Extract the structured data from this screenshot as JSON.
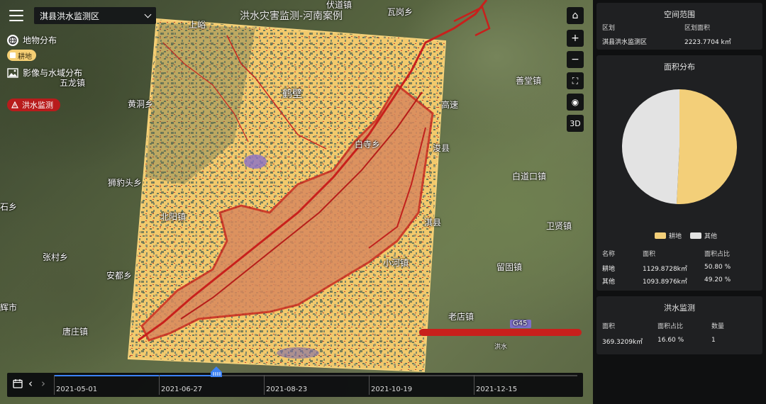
{
  "map": {
    "title": "洪水灾害监测-河南案例",
    "region_select": "淇县洪水监测区",
    "place_labels": [
      {
        "name": "上峪",
        "id": "shangyu"
      },
      {
        "name": "伏道镇",
        "id": "fudao"
      },
      {
        "name": "瓦岗乡",
        "id": "wagang"
      },
      {
        "name": "五龙镇",
        "id": "wulong"
      },
      {
        "name": "鹤壁",
        "id": "hebi"
      },
      {
        "name": "黄洞乡",
        "id": "huangdong"
      },
      {
        "name": "善堂镇",
        "id": "shantang"
      },
      {
        "name": "高速",
        "id": "gaosu"
      },
      {
        "name": "浚县",
        "id": "xunxian"
      },
      {
        "name": "白寺乡",
        "id": "baisi"
      },
      {
        "name": "白道口镇",
        "id": "baidaokou"
      },
      {
        "name": "狮豹头乡",
        "id": "shibaotou"
      },
      {
        "name": "石乡",
        "id": "shixiang"
      },
      {
        "name": "北阳镇",
        "id": "beiyang"
      },
      {
        "name": "淇县",
        "id": "qixian"
      },
      {
        "name": "张村乡",
        "id": "zhangcun"
      },
      {
        "name": "安都乡",
        "id": "andu"
      },
      {
        "name": "小河镇",
        "id": "xiaohe"
      },
      {
        "name": "留固镇",
        "id": "liugu"
      },
      {
        "name": "卫贤镇",
        "id": "weixian"
      },
      {
        "name": "老店镇",
        "id": "laodian"
      },
      {
        "name": "唐庄镇",
        "id": "tangzhuang"
      },
      {
        "name": "辉市",
        "id": "huishi"
      },
      {
        "name": "G45",
        "id": "g45"
      },
      {
        "name": "洪水",
        "id": "hongshui"
      }
    ]
  },
  "layers": {
    "land_use": "地物分布",
    "farmland_chip": "耕地",
    "imagery": "影像与水域分布",
    "flood": "洪水监测"
  },
  "toolbar": {
    "home": "⌂",
    "zoom_in": "+",
    "zoom_out": "−",
    "fullscreen": "⛶",
    "visibility": "◉",
    "view3d": "3D"
  },
  "timeline": {
    "dates": [
      "2021-05-01",
      "2021-06-27",
      "2021-08-23",
      "2021-10-19",
      "2021-12-15"
    ],
    "current_position": 0.31
  },
  "panel": {
    "extent": {
      "title": "空间范围",
      "head_region": "区划",
      "head_area": "区划面积",
      "region": "淇县洪水监测区",
      "area": "2223.7704 k㎡"
    },
    "distribution": {
      "title": "面积分布",
      "legend": [
        {
          "label": "耕地",
          "color": "#f3cf79"
        },
        {
          "label": "其他",
          "color": "#e3e3e3"
        }
      ],
      "headers": [
        "名称",
        "面积",
        "面积占比"
      ],
      "rows": [
        {
          "name": "耕地",
          "area": "1129.8728k㎡",
          "ratio": "50.80 %"
        },
        {
          "name": "其他",
          "area": "1093.8976k㎡",
          "ratio": "49.20 %"
        }
      ]
    },
    "flood": {
      "title": "洪水监测",
      "headers": [
        "面积",
        "面积占比",
        "数量"
      ],
      "row": {
        "area": "369.3209k㎡",
        "ratio": "16.60 %",
        "count": "1"
      }
    }
  },
  "chart_data": {
    "type": "pie",
    "title": "面积分布",
    "categories": [
      "耕地",
      "其他"
    ],
    "values": [
      50.8,
      49.2
    ],
    "colors": [
      "#f3cf79",
      "#e3e3e3"
    ],
    "legend": "bottom"
  }
}
